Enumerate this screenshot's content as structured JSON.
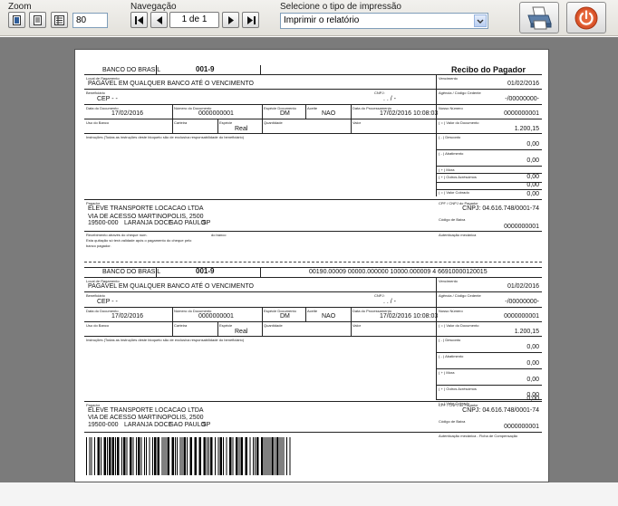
{
  "toolbar": {
    "zoom_label": "Zoom",
    "zoom_value": "80",
    "nav_label": "Navegação",
    "page_indicator": "1 de 1",
    "print_type_label": "Selecione o tipo de impressão",
    "print_type_value": "Imprimir o relatório"
  },
  "receipt": {
    "bank_name": "BANCO DO BRASIL",
    "bank_code": "001-9",
    "title": "Recibo do Pagador",
    "l_local": "Local de Pagamento",
    "local": "PAGÁVEL EM QUALQUER BANCO ATÉ O VENCIMENTO",
    "l_vencimento": "Vencimento",
    "vencimento": "01/02/2016",
    "l_beneficiario": "Beneficiário",
    "beneficiario": "CEP - -",
    "l_cnpj": "CNPJ:",
    "cnpj": ". . / -",
    "l_agencia": "Agência / Código Cedente",
    "agencia": "-/00000000-",
    "l_data_doc": "Data do Documento",
    "data_doc": "17/02/2016",
    "l_num_doc": "Número do Documento",
    "num_doc": "0000000001",
    "l_especie_doc": "Espécie Documento",
    "especie_doc": "DM",
    "l_aceite": "Aceite",
    "aceite": "NAO",
    "l_data_proc": "Data do Processamento",
    "data_proc": "17/02/2016 10:08:03",
    "l_nosso": "Nosso Número",
    "nosso": "0000000001",
    "l_uso_banco": "Uso do Banco",
    "l_carteira": "Carteira",
    "l_especie": "Espécie",
    "especie": "Real",
    "l_quantidade": "Quantidade",
    "l_valor": "Valor",
    "l_valor_doc": "( = ) Valor do Documento",
    "valor_doc": "1.200,15",
    "l_instrucoes": "Instruções (Todas as instruções deste bloqueto são de exclusiva responsabilidade do beneficiário)",
    "l_desconto": "( - ) Desconto",
    "desconto": "0,00",
    "l_abatimento": "( - ) Abatimento",
    "abatimento": "0,00",
    "l_mora": "( + ) Mora",
    "mora": "0,00",
    "l_outros": "( + ) Outros Acréscimos",
    "outros": "0,00",
    "l_cobrado": "( = ) Valor Cobrado",
    "cobrado": "0,00",
    "l_pagador": "Pagador",
    "pagador_name": "ELEVE TRANSPORTE LOCACAO LTDA",
    "pagador_addr": "VIA DE ACESSO MARTINOPOLIS, 2500",
    "pagador_cep": "19500-000",
    "pagador_bairro": "LARANJA DOCE",
    "pagador_city": "SAO PAULO",
    "pagador_uf": "SP",
    "l_cpf": "CPF / CNPJ do Pagador",
    "cpf": "CNPJ: 04.616.748/0001-74",
    "l_cod_baixa": "Código de Baixa",
    "cod_baixa": "0000000001",
    "receb_text": "Recebimento através do cheque num.",
    "receb_banco": "do banco",
    "receb_text2": "Esta quitação só terá validade após o pagamento do cheque pelo",
    "receb_text3": "banco pagador.",
    "l_autent": "Autenticação mecânica"
  },
  "slip": {
    "bank_name": "BANCO DO BRASIL",
    "bank_code": "001-9",
    "linha_digitavel": "00190.00009 00000.000000 10000.000009 4 66910000120015",
    "l_local": "Local de Pagamento",
    "local": "PAGÁVEL EM QUALQUER BANCO ATÉ O VENCIMENTO",
    "l_vencimento": "Vencimento",
    "vencimento": "01/02/2016",
    "l_beneficiario": "Beneficiário",
    "beneficiario": "CEP - -",
    "l_cnpj": "CNPJ:",
    "cnpj": ". . / -",
    "l_agencia": "Agência / Código Cedente",
    "agencia": "-/00000000-",
    "l_data_doc": "Data do Documento",
    "data_doc": "17/02/2016",
    "l_num_doc": "Número do Documento",
    "num_doc": "0000000001",
    "l_especie_doc": "Espécie Documento",
    "especie_doc": "DM",
    "l_aceite": "Aceite",
    "aceite": "NAO",
    "l_data_proc": "Data do Processamento",
    "data_proc": "17/02/2016 10:08:03",
    "l_nosso": "Nosso Número",
    "nosso": "0000000001",
    "l_uso_banco": "Uso do Banco",
    "l_carteira": "Carteira",
    "l_especie": "Espécie",
    "especie": "Real",
    "l_quantidade": "Quantidade",
    "l_valor": "Valor",
    "l_valor_doc": "( = ) Valor do Documento",
    "valor_doc": "1.200,15",
    "l_instrucoes": "Instruções (Todas as instruções deste bloqueto são de exclusiva responsabilidade do beneficiário)",
    "l_desconto": "( - ) Desconto",
    "desconto": "0,00",
    "l_abatimento": "( - ) Abatimento",
    "abatimento": "0,00",
    "l_mora": "( + ) Mora",
    "mora": "0,00",
    "l_outros": "( + ) Outros Acréscimos",
    "outros": "0,00",
    "l_cobrado": "( = ) Valor Cobrado",
    "cobrado": "0,00",
    "l_pagador": "Pagador",
    "pagador_name": "ELEVE TRANSPORTE LOCACAO LTDA",
    "pagador_addr": "VIA DE ACESSO MARTINOPOLIS, 2500",
    "pagador_cep": "19500-000",
    "pagador_bairro": "LARANJA DOCE",
    "pagador_city": "SAO PAULO",
    "pagador_uf": "SP",
    "l_cpf": "CPF / CNPJ do Pagador",
    "cpf": "CNPJ: 04.616.748/0001-74",
    "l_cod_baixa": "Código de Baixa",
    "cod_baixa": "0000000001",
    "l_autent": "Autenticação mecânica - Ficha de Compensação"
  },
  "icons": {
    "print": "printer-icon",
    "exit": "power-icon"
  }
}
